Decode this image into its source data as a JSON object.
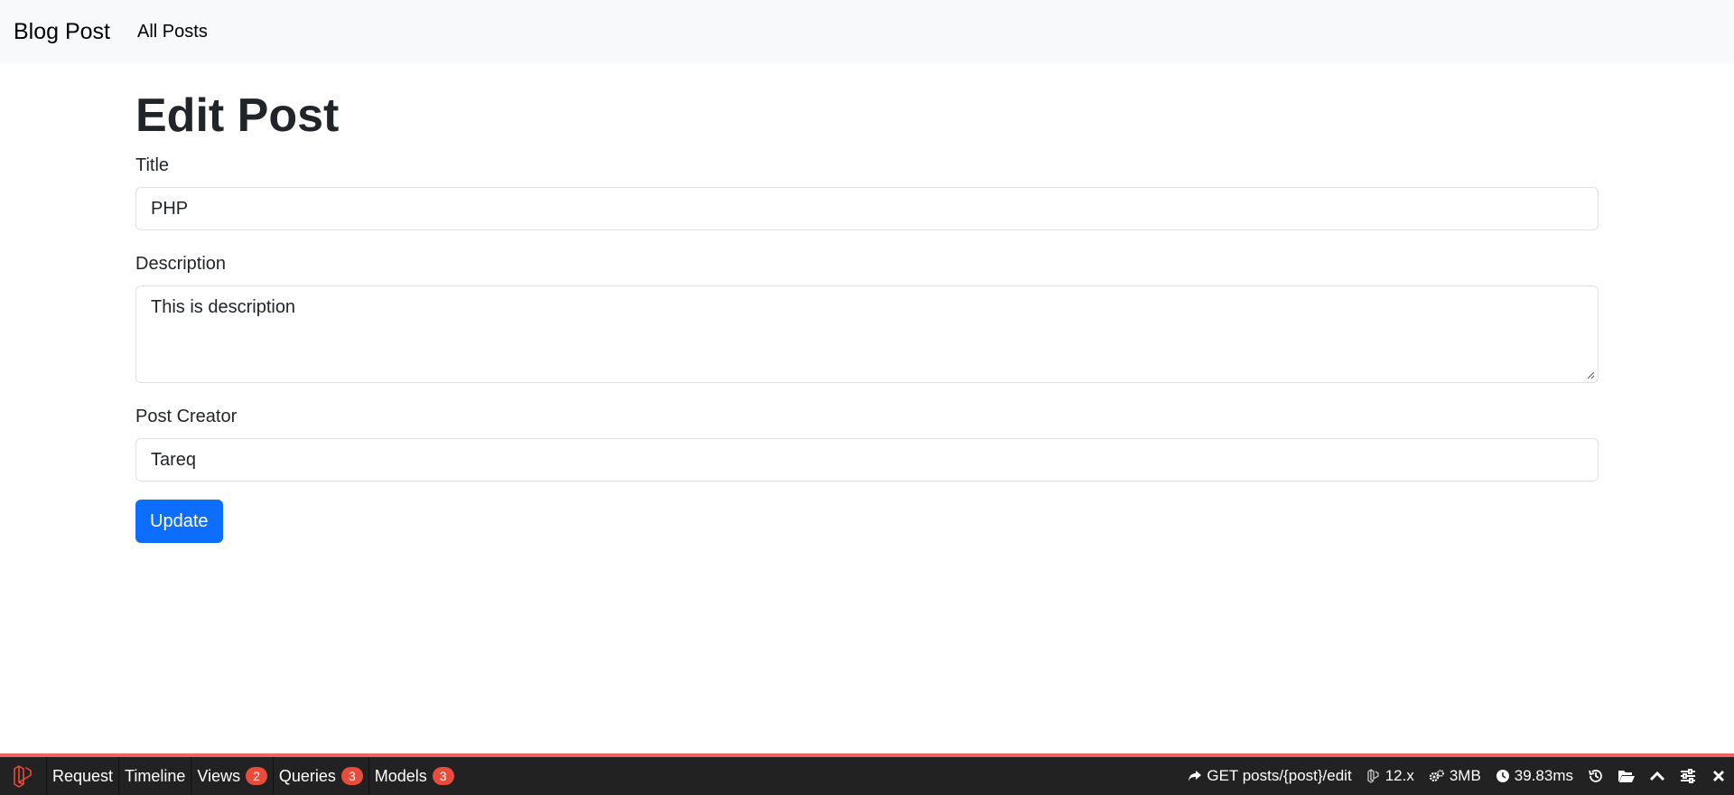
{
  "navbar": {
    "brand": "Blog Post",
    "link": "All Posts"
  },
  "form": {
    "heading": "Edit Post",
    "title_label": "Title",
    "title_value": "PHP",
    "description_label": "Description",
    "description_value": "This is description",
    "creator_label": "Post Creator",
    "creator_value": "Tareq",
    "submit_label": "Update"
  },
  "debugbar": {
    "tabs": [
      {
        "label": "Request"
      },
      {
        "label": "Timeline"
      },
      {
        "label": "Views",
        "badge": "2"
      },
      {
        "label": "Queries",
        "badge": "3"
      },
      {
        "label": "Models",
        "badge": "3"
      }
    ],
    "route": "GET posts/{post}/edit",
    "version": "12.x",
    "memory": "3MB",
    "time": "39.83ms",
    "accent_color": "#f4645f"
  }
}
